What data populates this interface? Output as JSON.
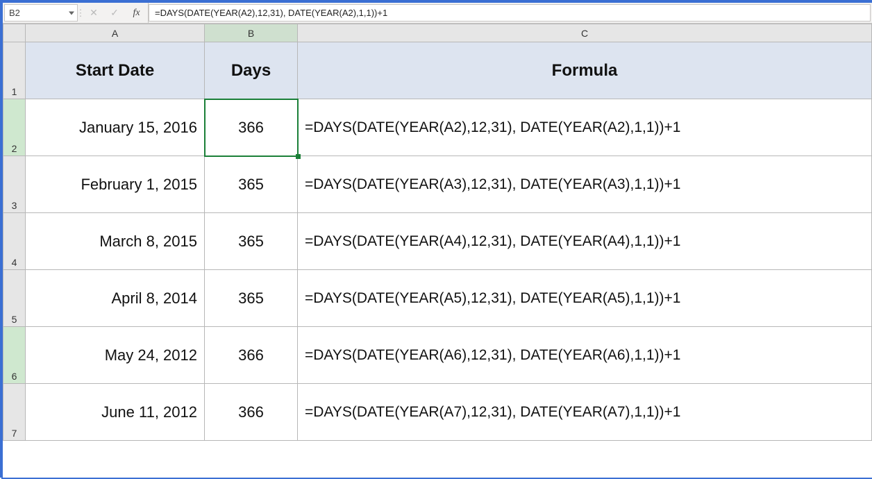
{
  "formula_bar": {
    "name_box": "B2",
    "fx_label": "fx",
    "cancel_icon": "✕",
    "confirm_icon": "✓",
    "formula": "=DAYS(DATE(YEAR(A2),12,31), DATE(YEAR(A2),1,1))+1"
  },
  "columns": {
    "A": "A",
    "B": "B",
    "C": "C"
  },
  "row_labels": [
    "1",
    "2",
    "3",
    "4",
    "5",
    "6",
    "7"
  ],
  "headers": {
    "start_date": "Start Date",
    "days": "Days",
    "formula": "Formula"
  },
  "rows": [
    {
      "start_date": "January 15, 2016",
      "days": "366",
      "formula": "=DAYS(DATE(YEAR(A2),12,31), DATE(YEAR(A2),1,1))+1"
    },
    {
      "start_date": "February 1, 2015",
      "days": "365",
      "formula": "=DAYS(DATE(YEAR(A3),12,31), DATE(YEAR(A3),1,1))+1"
    },
    {
      "start_date": "March 8, 2015",
      "days": "365",
      "formula": "=DAYS(DATE(YEAR(A4),12,31), DATE(YEAR(A4),1,1))+1"
    },
    {
      "start_date": "April 8, 2014",
      "days": "365",
      "formula": "=DAYS(DATE(YEAR(A5),12,31), DATE(YEAR(A5),1,1))+1"
    },
    {
      "start_date": "May 24, 2012",
      "days": "366",
      "formula": "=DAYS(DATE(YEAR(A6),12,31), DATE(YEAR(A6),1,1))+1"
    },
    {
      "start_date": "June 11, 2012",
      "days": "366",
      "formula": "=DAYS(DATE(YEAR(A7),12,31), DATE(YEAR(A7),1,1))+1"
    }
  ],
  "selected_cell": "B2",
  "selected_row_index": 5
}
